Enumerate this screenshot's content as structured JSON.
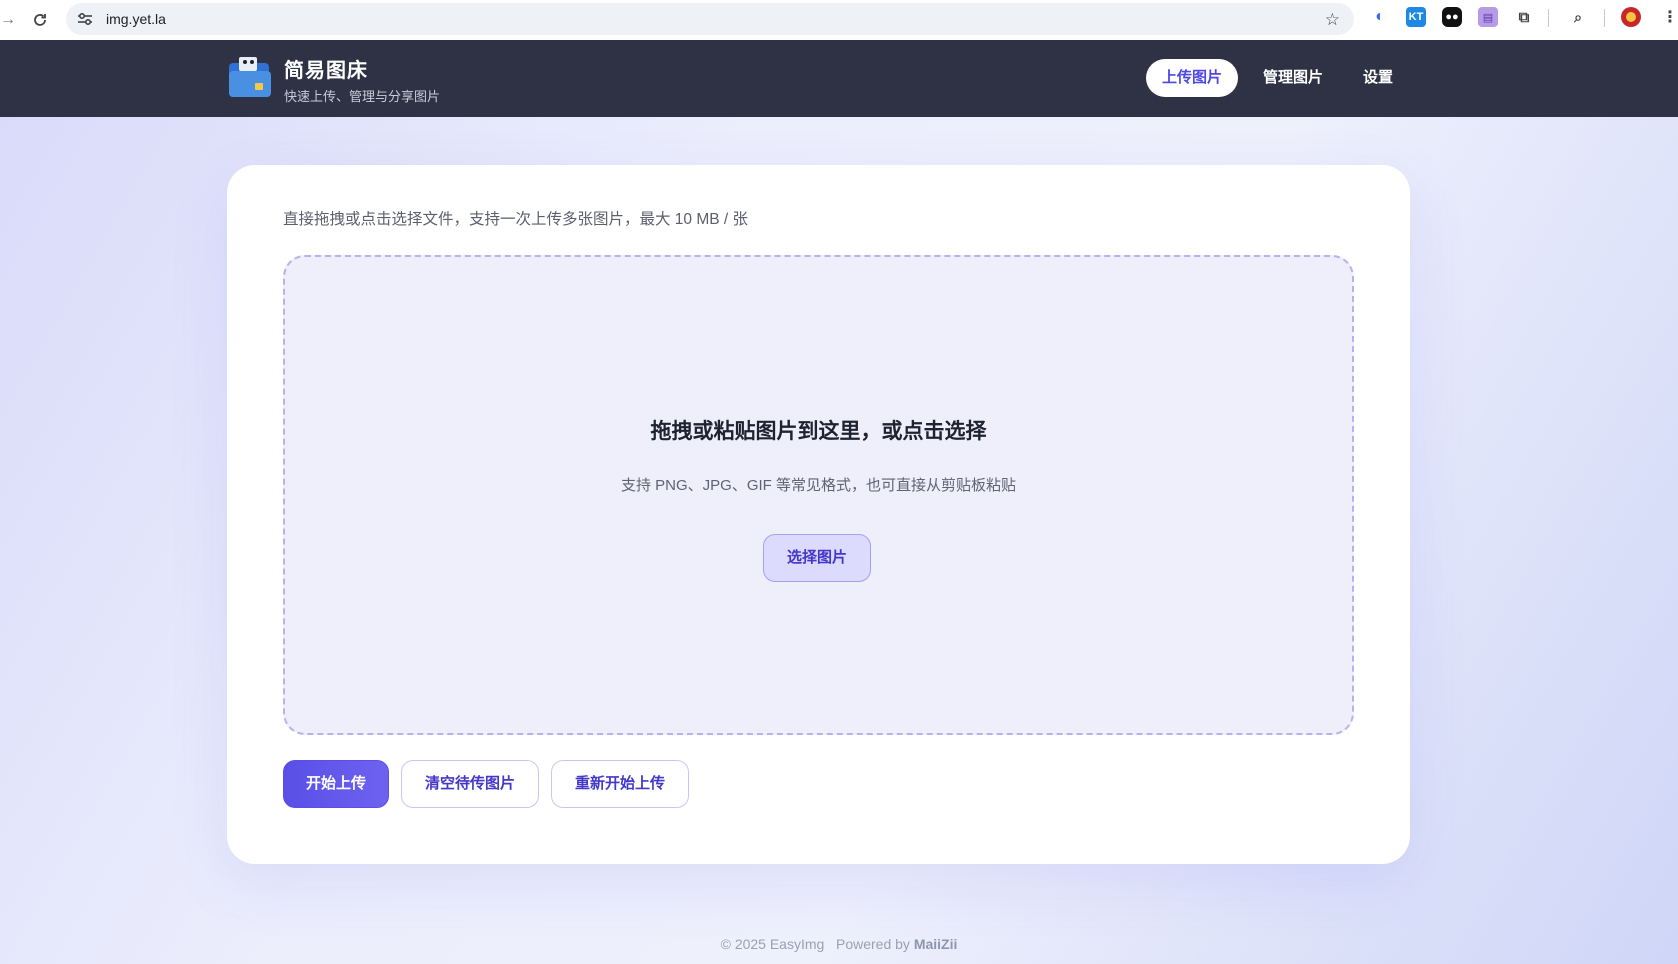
{
  "browser": {
    "url": "img.yet.la",
    "extensions": [
      "copilot-icon",
      "kt-extension-icon",
      "tampermonkey-icon",
      "reader-extension-icon",
      "puzzle-extensions-icon",
      "tab-search-icon",
      "profile-avatar-icon"
    ],
    "ext_kt_label": "KT"
  },
  "header": {
    "title": "简易图床",
    "subtitle": "快速上传、管理与分享图片",
    "nav": [
      {
        "label": "上传图片",
        "active": true
      },
      {
        "label": "管理图片",
        "active": false
      },
      {
        "label": "设置",
        "active": false
      }
    ]
  },
  "upload": {
    "hint": "直接拖拽或点击选择文件，支持一次上传多张图片，最大 10 MB / 张",
    "dropzone_title": "拖拽或粘贴图片到这里，或点击选择",
    "dropzone_subtitle": "支持 PNG、JPG、GIF 等常见格式，也可直接从剪贴板粘贴",
    "select_button": "选择图片",
    "actions": {
      "start": "开始上传",
      "clear": "清空待传图片",
      "restart": "重新开始上传"
    }
  },
  "footer": {
    "copyright": "© 2025 EasyImg",
    "powered_by": "Powered by",
    "author": "MaiiZii"
  },
  "colors": {
    "header_bg": "#2e3244",
    "accent": "#4f46e5",
    "dropzone_bg": "#efeefb"
  }
}
